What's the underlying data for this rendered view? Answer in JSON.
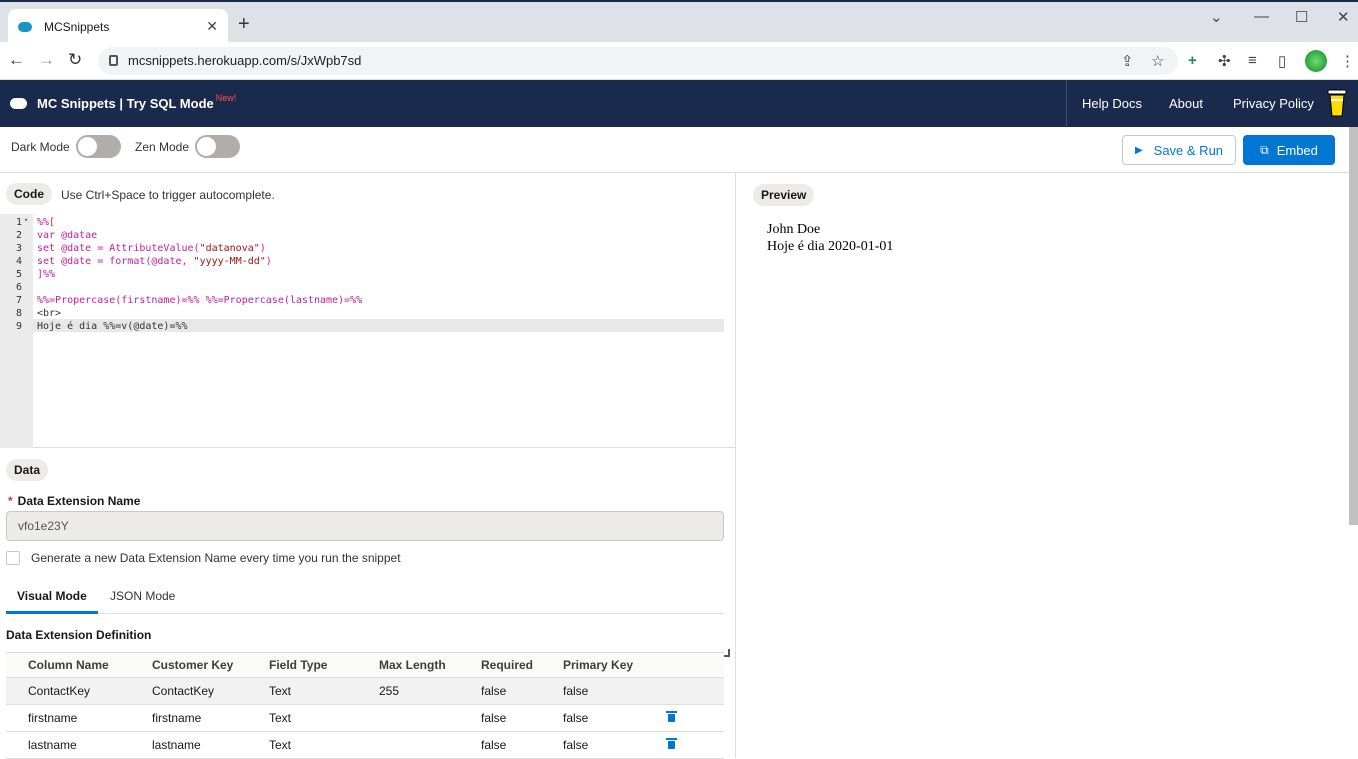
{
  "browser": {
    "tab_title": "MCSnippets",
    "url": "mcsnippets.herokuapp.com/s/JxWpb7sd"
  },
  "header": {
    "brand": "MC Snippets | Try SQL Mode",
    "new_badge": "New!",
    "nav": [
      "Help Docs",
      "About",
      "Privacy Policy"
    ]
  },
  "toolbar": {
    "dark_mode_label": "Dark Mode",
    "zen_mode_label": "Zen Mode",
    "save_run_label": "Save & Run",
    "embed_label": "Embed"
  },
  "code": {
    "label": "Code",
    "hint": "Use Ctrl+Space to trigger autocomplete.",
    "line_numbers": [
      "1",
      "2",
      "3",
      "4",
      "5",
      "6",
      "7",
      "8",
      "9"
    ],
    "lines": [
      "%%[",
      "var @datae",
      "set @date = AttributeValue(\"datanova\")",
      "set @date = format(@date, \"yyyy-MM-dd\")",
      "]%%",
      "",
      "%%=Propercase(firstname)=%% %%=Propercase(lastname)=%%",
      "<br>",
      "Hoje é dia %%=v(@date)=%%"
    ]
  },
  "data": {
    "label": "Data",
    "de_name_label": "Data Extension Name",
    "de_name_value": "vfo1e23Y",
    "generate_label": "Generate a new Data Extension Name every time you run the snippet",
    "tabs": [
      "Visual Mode",
      "JSON Mode"
    ],
    "definition_label": "Data Extension Definition",
    "columns": [
      "Column Name",
      "Customer Key",
      "Field Type",
      "Max Length",
      "Required",
      "Primary Key"
    ],
    "rows": [
      [
        "ContactKey",
        "ContactKey",
        "Text",
        "255",
        "false",
        "false"
      ],
      [
        "firstname",
        "firstname",
        "Text",
        "",
        "false",
        "false"
      ],
      [
        "lastname",
        "lastname",
        "Text",
        "",
        "false",
        "false"
      ]
    ]
  },
  "preview": {
    "label": "Preview",
    "line1": "John Doe",
    "line2": "Hoje é dia 2020-01-01"
  },
  "colors": {
    "header_bg": "#192a4c",
    "accent": "#0176d3"
  }
}
